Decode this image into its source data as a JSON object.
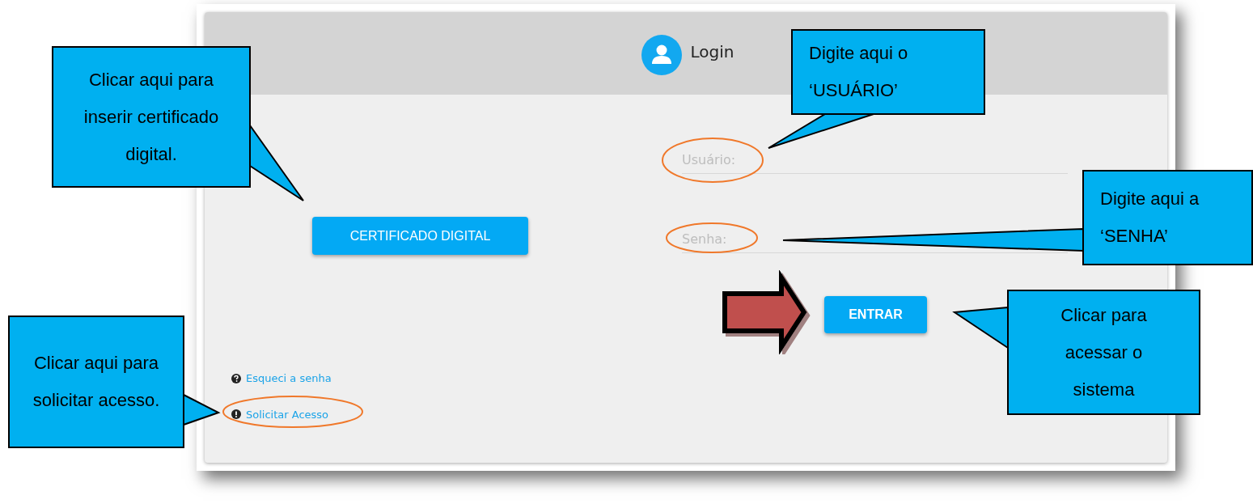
{
  "header": {
    "title": "Login"
  },
  "certificate_button": "CERTIFICADO DIGITAL",
  "fields": [
    {
      "placeholder": "Usuário:"
    },
    {
      "placeholder": "Senha:"
    }
  ],
  "submit_button": "ENTRAR",
  "links": [
    {
      "kind": "question",
      "label": "Esqueci a senha"
    },
    {
      "kind": "alert",
      "label": "Solicitar Acesso"
    }
  ],
  "callouts": [
    {
      "text": "Clicar aqui para inserir certificado digital."
    },
    {
      "text": "Digite aqui o ‘USUÁRIO’"
    },
    {
      "text": "Digite aqui a ‘SENHA’"
    },
    {
      "text": "Clicar para acessar o sistema"
    },
    {
      "text": "Clicar aqui para solicitar acesso."
    }
  ]
}
